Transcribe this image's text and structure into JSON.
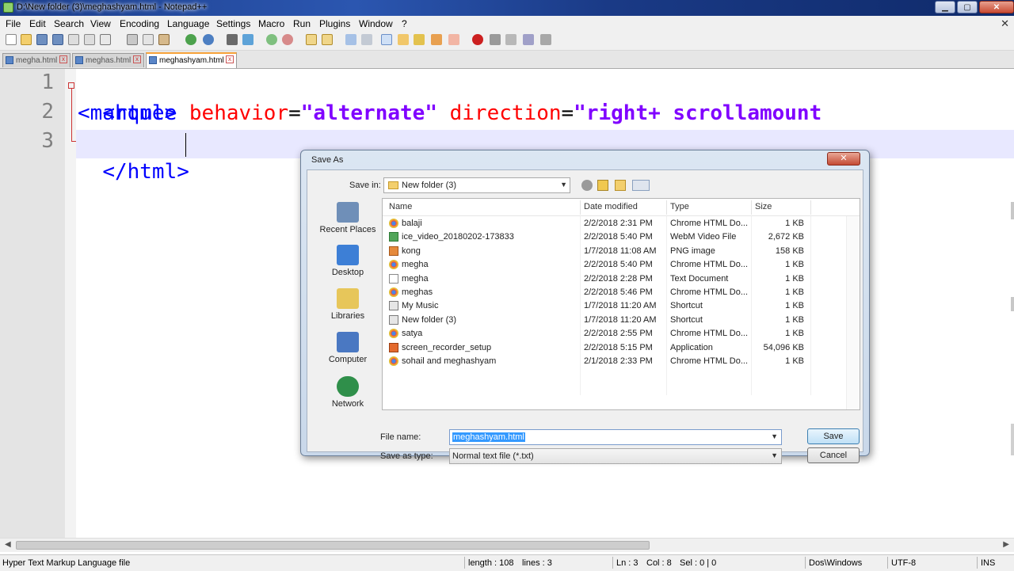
{
  "window": {
    "title": "D:\\New folder (3)\\meghashyam.html - Notepad++",
    "minimize": "▁",
    "maximize": "▢",
    "close": "✕"
  },
  "menu": [
    "File",
    "Edit",
    "Search",
    "View",
    "Encoding",
    "Language",
    "Settings",
    "Macro",
    "Run",
    "Plugins",
    "Window",
    "?"
  ],
  "menu_close": "✕",
  "tabs": [
    {
      "label": "megha.html",
      "active": false
    },
    {
      "label": "meghas.html",
      "active": false
    },
    {
      "label": "meghashyam.html",
      "active": true
    }
  ],
  "editor": {
    "line_numbers": [
      "1",
      "2",
      "3"
    ],
    "line1": "<html>",
    "line2_tag": "<marquee",
    "line2_attr1": " behavior",
    "line2_eq1": "=",
    "line2_val1": "\"alternate\"",
    "line2_attr2": " direction",
    "line2_eq2": "=",
    "line2_val2": "\"right+ scrollamount",
    "line3": "</html>"
  },
  "status": {
    "file_type": "Hyper Text Markup Language file",
    "length": "length : 108",
    "lines": "lines : 3",
    "ln": "Ln : 3",
    "col": "Col : 8",
    "sel": "Sel : 0 | 0",
    "eol": "Dos\\Windows",
    "encoding": "UTF-8",
    "mode": "INS"
  },
  "dialog": {
    "title": "Save As",
    "close": "✕",
    "save_in_label": "Save in:",
    "save_in_value": "New folder (3)",
    "places": [
      {
        "label": "Recent Places",
        "icon": "recent-places-icon",
        "color": "#6f8fb8"
      },
      {
        "label": "Desktop",
        "icon": "desktop-icon",
        "color": "#3d7fd6"
      },
      {
        "label": "Libraries",
        "icon": "libraries-icon",
        "color": "#e7c65a"
      },
      {
        "label": "Computer",
        "icon": "computer-icon",
        "color": "#4a78c2"
      },
      {
        "label": "Network",
        "icon": "network-icon",
        "color": "#2f8f4a"
      }
    ],
    "columns": {
      "name": "Name",
      "date": "Date modified",
      "type": "Type",
      "size": "Size"
    },
    "files": [
      {
        "name": "balaji",
        "date": "2/2/2018 2:31 PM",
        "type": "Chrome HTML Do...",
        "size": "1 KB",
        "icon": "chrome-icon"
      },
      {
        "name": "ice_video_20180202-173833",
        "date": "2/2/2018 5:40 PM",
        "type": "WebM Video File",
        "size": "2,672 KB",
        "icon": "video-icon"
      },
      {
        "name": "kong",
        "date": "1/7/2018 11:08 AM",
        "type": "PNG image",
        "size": "158 KB",
        "icon": "image-icon"
      },
      {
        "name": "megha",
        "date": "2/2/2018 5:40 PM",
        "type": "Chrome HTML Do...",
        "size": "1 KB",
        "icon": "chrome-icon"
      },
      {
        "name": "megha",
        "date": "2/2/2018 2:28 PM",
        "type": "Text Document",
        "size": "1 KB",
        "icon": "text-file-icon"
      },
      {
        "name": "meghas",
        "date": "2/2/2018 5:46 PM",
        "type": "Chrome HTML Do...",
        "size": "1 KB",
        "icon": "chrome-icon"
      },
      {
        "name": "My Music",
        "date": "1/7/2018 11:20 AM",
        "type": "Shortcut",
        "size": "1 KB",
        "icon": "shortcut-icon"
      },
      {
        "name": "New folder (3)",
        "date": "1/7/2018 11:20 AM",
        "type": "Shortcut",
        "size": "1 KB",
        "icon": "shortcut-icon"
      },
      {
        "name": "satya",
        "date": "2/2/2018 2:55 PM",
        "type": "Chrome HTML Do...",
        "size": "1 KB",
        "icon": "chrome-icon"
      },
      {
        "name": "screen_recorder_setup",
        "date": "2/2/2018 5:15 PM",
        "type": "Application",
        "size": "54,096 KB",
        "icon": "application-icon"
      },
      {
        "name": "sohail and meghashyam",
        "date": "2/1/2018 2:33 PM",
        "type": "Chrome HTML Do...",
        "size": "1 KB",
        "icon": "chrome-icon"
      }
    ],
    "file_name_label": "File name:",
    "file_name_value": "meghashyam.html",
    "save_as_type_label": "Save as type:",
    "save_as_type_value": "Normal text file (*.txt)",
    "save_button": "Save",
    "cancel_button": "Cancel"
  },
  "colors": {
    "tag": "#0000ff",
    "attribute": "#ff0000",
    "string": "#8000ff",
    "current_line": "#e8e8ff"
  }
}
